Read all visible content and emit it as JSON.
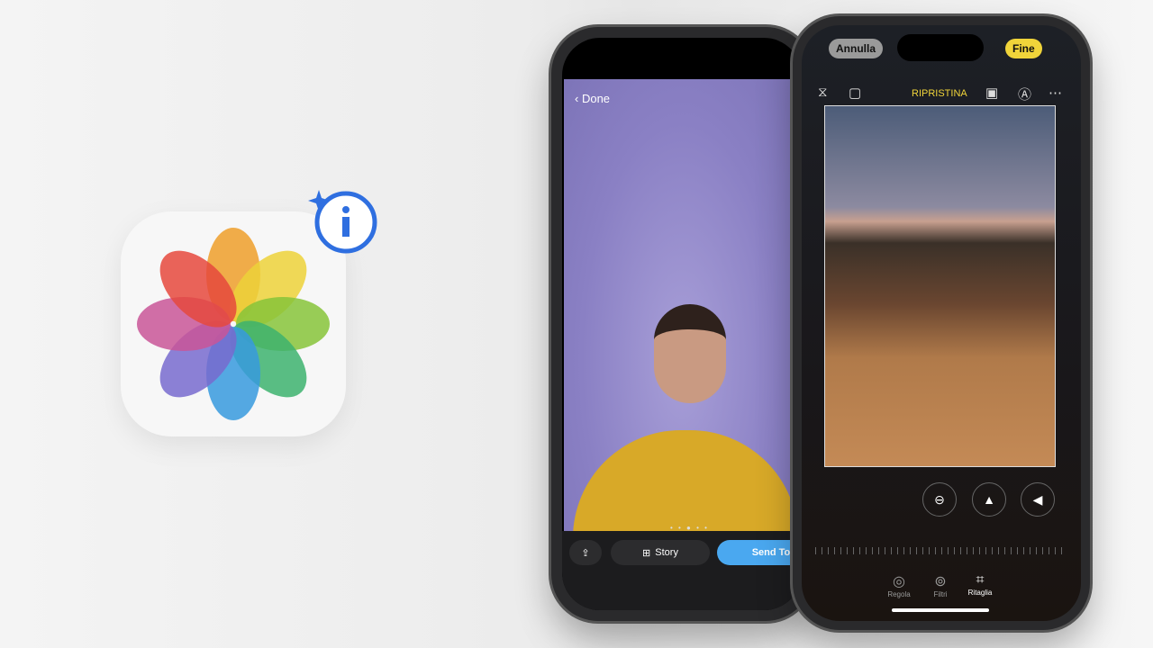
{
  "app_icon": {
    "name": "photos-app-icon",
    "badge": "sparkle-info-icon"
  },
  "left_phone": {
    "back_label": "Done",
    "page_dots": "• • ● • •",
    "share_icon": "share-icon",
    "story_label": "Story",
    "send_label": "Send To",
    "colors": {
      "send": "#4aa8f0"
    }
  },
  "right_phone": {
    "cancel_label": "Annulla",
    "done_label": "Fine",
    "reset_label": "RIPRISTINA",
    "tabs": [
      {
        "label": "Regola"
      },
      {
        "label": "Filtri"
      },
      {
        "label": "Ritaglia"
      }
    ],
    "active_tab": "Ritaglia",
    "colors": {
      "accent": "#f0d43a"
    }
  }
}
